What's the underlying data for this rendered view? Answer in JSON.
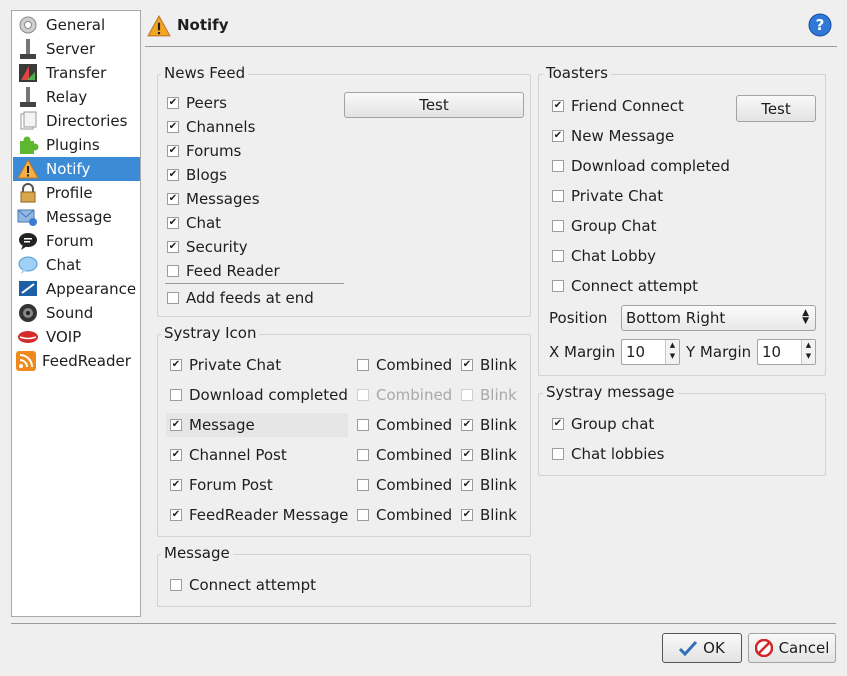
{
  "sidebar": {
    "items": [
      {
        "label": "General",
        "icon": "gear-icon"
      },
      {
        "label": "Server",
        "icon": "server-icon"
      },
      {
        "label": "Transfer",
        "icon": "transfer-icon"
      },
      {
        "label": "Relay",
        "icon": "relay-icon"
      },
      {
        "label": "Directories",
        "icon": "folder-icon"
      },
      {
        "label": "Plugins",
        "icon": "puzzle-icon"
      },
      {
        "label": "Notify",
        "icon": "warning-icon"
      },
      {
        "label": "Profile",
        "icon": "lock-icon"
      },
      {
        "label": "Message",
        "icon": "message-icon"
      },
      {
        "label": "Forum",
        "icon": "forum-icon"
      },
      {
        "label": "Chat",
        "icon": "chat-bubble-icon"
      },
      {
        "label": "Appearance",
        "icon": "appearance-icon"
      },
      {
        "label": "Sound",
        "icon": "speaker-icon"
      },
      {
        "label": "VOIP",
        "icon": "lips-icon"
      },
      {
        "label": "FeedReader",
        "icon": "rss-icon"
      }
    ],
    "selected": "Notify"
  },
  "header": {
    "title": "Notify",
    "help_icon": "help-icon"
  },
  "news_feed": {
    "title": "News Feed",
    "test_label": "Test",
    "items": [
      {
        "label": "Peers",
        "checked": true
      },
      {
        "label": "Channels",
        "checked": true
      },
      {
        "label": "Forums",
        "checked": true
      },
      {
        "label": "Blogs",
        "checked": true
      },
      {
        "label": "Messages",
        "checked": true
      },
      {
        "label": "Chat",
        "checked": true
      },
      {
        "label": "Security",
        "checked": true
      },
      {
        "label": "Feed Reader",
        "checked": false
      }
    ],
    "add_feeds_at_end": {
      "label": "Add feeds at end",
      "checked": false
    }
  },
  "systray_icon": {
    "title": "Systray Icon",
    "rows": [
      {
        "label": "Private Chat",
        "checked": true,
        "combined": "Combined",
        "combined_checked": false,
        "blink": "Blink",
        "blink_checked": true,
        "disabled": false
      },
      {
        "label": "Download completed",
        "checked": false,
        "combined": "Combined",
        "combined_checked": false,
        "blink": "Blink",
        "blink_checked": false,
        "disabled": true
      },
      {
        "label": "Message",
        "checked": true,
        "combined": "Combined",
        "combined_checked": false,
        "blink": "Blink",
        "blink_checked": true,
        "disabled": false
      },
      {
        "label": "Channel Post",
        "checked": true,
        "combined": "Combined",
        "combined_checked": false,
        "blink": "Blink",
        "blink_checked": true,
        "disabled": false
      },
      {
        "label": "Forum Post",
        "checked": true,
        "combined": "Combined",
        "combined_checked": false,
        "blink": "Blink",
        "blink_checked": true,
        "disabled": false
      },
      {
        "label": "FeedReader Message",
        "checked": true,
        "combined": "Combined",
        "combined_checked": false,
        "blink": "Blink",
        "blink_checked": true,
        "disabled": false
      }
    ]
  },
  "message_group": {
    "title": "Message",
    "items": [
      {
        "label": "Connect attempt",
        "checked": false
      }
    ]
  },
  "toasters": {
    "title": "Toasters",
    "test_label": "Test",
    "items": [
      {
        "label": "Friend Connect",
        "checked": true
      },
      {
        "label": "New Message",
        "checked": true
      },
      {
        "label": "Download completed",
        "checked": false
      },
      {
        "label": "Private Chat",
        "checked": false
      },
      {
        "label": "Group Chat",
        "checked": false
      },
      {
        "label": "Chat Lobby",
        "checked": false
      },
      {
        "label": "Connect attempt",
        "checked": false
      }
    ],
    "position_label": "Position",
    "position_value": "Bottom Right",
    "x_margin_label": "X Margin",
    "x_margin_value": "10",
    "y_margin_label": "Y Margin",
    "y_margin_value": "10"
  },
  "systray_message": {
    "title": "Systray message",
    "items": [
      {
        "label": "Group chat",
        "checked": true
      },
      {
        "label": "Chat lobbies",
        "checked": false
      }
    ]
  },
  "footer": {
    "ok_label": "OK",
    "cancel_label": "Cancel"
  },
  "colors": {
    "selection": "#3b8bd6",
    "warning": "#f08a1c",
    "help": "#2e78d8"
  }
}
